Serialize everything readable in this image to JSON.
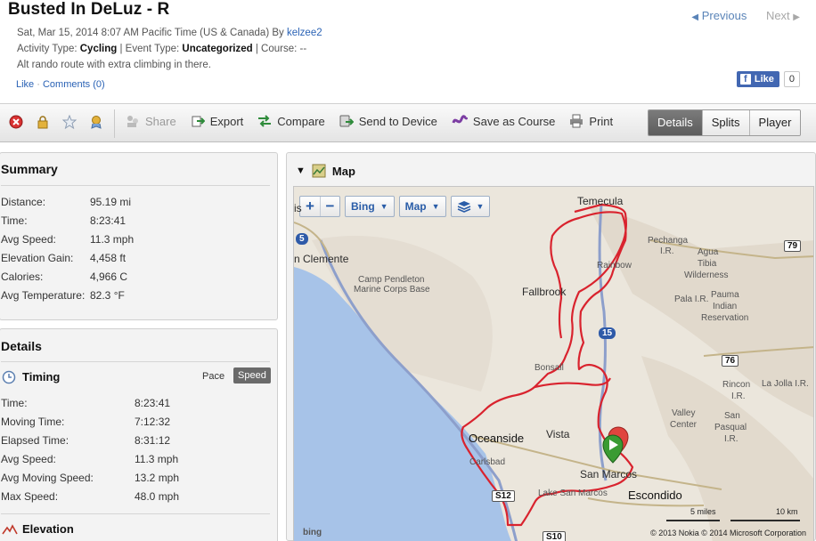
{
  "header": {
    "title": "Busted In DeLuz - R",
    "date_line": "Sat, Mar 15, 2014 8:07 AM Pacific Time (US & Canada) By",
    "author": "kelzee2",
    "activity_type_label": "Activity Type:",
    "activity_type": "Cycling",
    "event_type_label": "| Event Type:",
    "event_type": "Uncategorized",
    "course_label": "| Course: --",
    "description": "Alt rando route with extra climbing in there.",
    "like_link": "Like",
    "dot": "·",
    "comments_link": "Comments (0)",
    "previous": "Previous",
    "next": "Next",
    "fb_like": "Like",
    "fb_count": "0"
  },
  "toolbar": {
    "icons": [
      "delete-icon",
      "lock-icon",
      "star-icon",
      "badge-icon"
    ],
    "actions": [
      {
        "label": "Share",
        "icon": "share-icon",
        "enabled": false
      },
      {
        "label": "Export",
        "icon": "export-icon",
        "enabled": true
      },
      {
        "label": "Compare",
        "icon": "compare-icon",
        "enabled": true
      },
      {
        "label": "Send to Device",
        "icon": "send-device-icon",
        "enabled": true
      },
      {
        "label": "Save as Course",
        "icon": "course-icon",
        "enabled": true
      },
      {
        "label": "Print",
        "icon": "print-icon",
        "enabled": true
      }
    ],
    "tabs": [
      {
        "label": "Details",
        "active": true
      },
      {
        "label": "Splits",
        "active": false
      },
      {
        "label": "Player",
        "active": false
      }
    ]
  },
  "summary": {
    "title": "Summary",
    "rows": [
      {
        "label": "Distance:",
        "value": "95.19 mi"
      },
      {
        "label": "Time:",
        "value": "8:23:41"
      },
      {
        "label": "Avg Speed:",
        "value": "11.3 mph"
      },
      {
        "label": "Elevation Gain:",
        "value": "4,458 ft"
      },
      {
        "label": "Calories:",
        "value": "4,966 C"
      },
      {
        "label": "Avg Temperature:",
        "value": "82.3 °F"
      }
    ]
  },
  "details": {
    "title": "Details",
    "timing": {
      "title": "Timing",
      "pace_label": "Pace",
      "speed_label": "Speed",
      "rows": [
        {
          "label": "Time:",
          "value": "8:23:41"
        },
        {
          "label": "Moving Time:",
          "value": "7:12:32"
        },
        {
          "label": "Elapsed Time:",
          "value": "8:31:12"
        },
        {
          "label": "Avg Speed:",
          "value": "11.3 mph"
        },
        {
          "label": "Avg Moving Speed:",
          "value": "13.2 mph"
        },
        {
          "label": "Max Speed:",
          "value": "48.0 mph"
        }
      ]
    },
    "elevation": {
      "title": "Elevation"
    }
  },
  "map": {
    "title": "Map",
    "controls": {
      "zoom_in": "+",
      "zoom_out": "−",
      "source": "Bing",
      "type": "Map"
    },
    "places": {
      "temecula": "Temecula",
      "clemente": "n Clemente",
      "pendleton1": "Camp Pendleton",
      "pendleton2": "Marine Corps Base",
      "fallbrook": "Fallbrook",
      "rainbow": "Rainbow",
      "pechanga1": "Pechanga",
      "pechanga2": "I.R.",
      "aguatibia1": "Agua",
      "aguatibia2": "Tibia",
      "aguatibia3": "Wilderness",
      "pala": "Pala I.R.",
      "pauma1": "Pauma",
      "pauma2": "Indian",
      "pauma3": "Reservation",
      "bonsall": "Bonsall",
      "oceanside": "Oceanside",
      "vista": "Vista",
      "carlsbad": "Carlsbad",
      "sanmarcos": "San Marcos",
      "lakesanmarcos": "Lake San Marcos",
      "escondido": "Escondido",
      "valley1": "Valley",
      "valley2": "Center",
      "rincon1": "Rincon",
      "rincon2": "I.R.",
      "lajolla": "La Jolla I.R.",
      "sanpasqual1": "San",
      "sanpasqual2": "Pasqual",
      "sanpasqual3": "I.R.",
      "isis": "is"
    },
    "shields": {
      "r79": "79",
      "r76": "76",
      "i15": "15",
      "s12": "S12",
      "s10": "S10",
      "i5": "5"
    },
    "scale_mi": "5 miles",
    "scale_km": "10 km",
    "copyright": "© 2013 Nokia   © 2014 Microsoft Corporation",
    "bing": "bing",
    "colors": {
      "water": "#a7c3e8",
      "land": "#ebe6dc",
      "route": "#d9232e",
      "roads": "#9aa7c9"
    }
  }
}
